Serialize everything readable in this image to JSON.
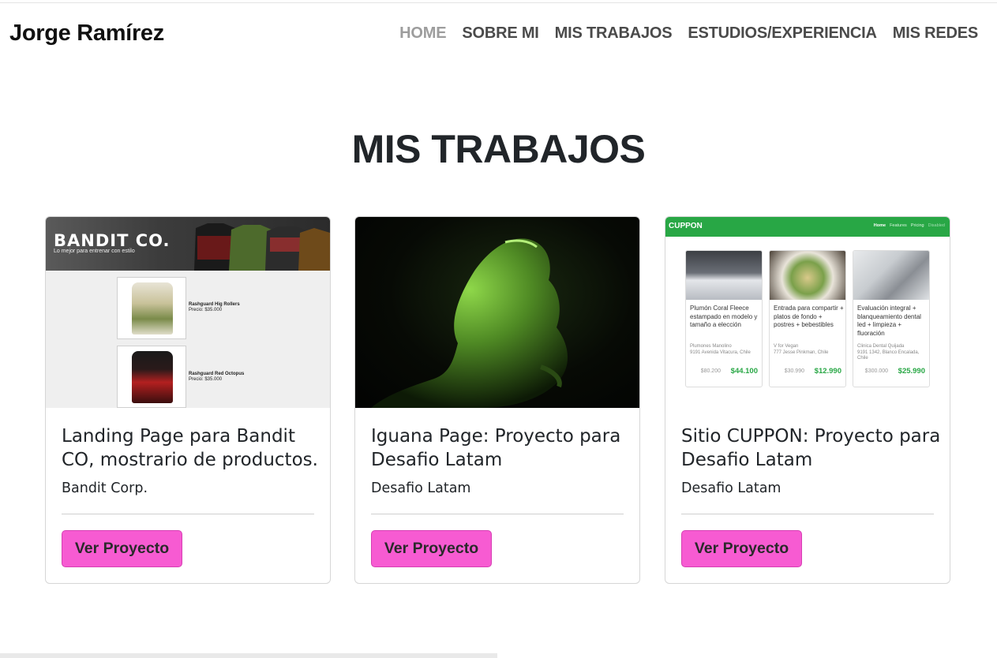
{
  "header": {
    "brand": "Jorge Ramírez",
    "nav": [
      "HOME",
      "SOBRE MI",
      "MIS TRABAJOS",
      "ESTUDIOS/EXPERIENCIA",
      "MIS REDES"
    ]
  },
  "section": {
    "title": "MIS TRABAJOS"
  },
  "colors": {
    "button": "#f75bd2",
    "cuppon_green": "#28a745"
  },
  "cards": [
    {
      "title": "Landing Page para Bandit CO, mostrario de productos.",
      "subtitle": "Bandit Corp.",
      "button": "Ver Proyecto",
      "preview": {
        "brand": "BANDIT CO.",
        "tagline": "Lo mejor para entrenar con estilo",
        "products": [
          {
            "name": "Rashguard Hig Rollers",
            "price": "Precio: $35.000"
          },
          {
            "name": "Rashguard Red Octopus",
            "price": "Precio: $35.000"
          }
        ]
      }
    },
    {
      "title": "Iguana Page: Proyecto para Desafio Latam",
      "subtitle": "Desafio Latam",
      "button": "Ver Proyecto"
    },
    {
      "title": "Sitio CUPPON: Proyecto para Desafio Latam",
      "subtitle": "Desafio Latam",
      "button": "Ver Proyecto",
      "preview": {
        "brand": "CUPPON",
        "links": [
          "Home",
          "Features",
          "Pricing",
          "Disabled"
        ],
        "offers": [
          {
            "title": "Plumón Coral Fleece estampado en modelo y tamaño a elección",
            "merchant": "Plumones Manolino",
            "address": "9191 Avenida Vitacura, Chile",
            "old_price": "$80.200",
            "price": "$44.100"
          },
          {
            "title": "Entrada para compartir + platos de fondo + postres + bebestibles",
            "merchant": "V for Vegan",
            "address": "777 Jesse Pinkman, Chile",
            "old_price": "$30.990",
            "price": "$12.990"
          },
          {
            "title": "Evaluación integral + blanqueamiento dental led + limpieza + fluoración",
            "merchant": "Clinica Dental Quijada",
            "address": "9191 1342, Blanco Encalada, Chile",
            "old_price": "$300.000",
            "price": "$25.990"
          }
        ]
      }
    }
  ]
}
